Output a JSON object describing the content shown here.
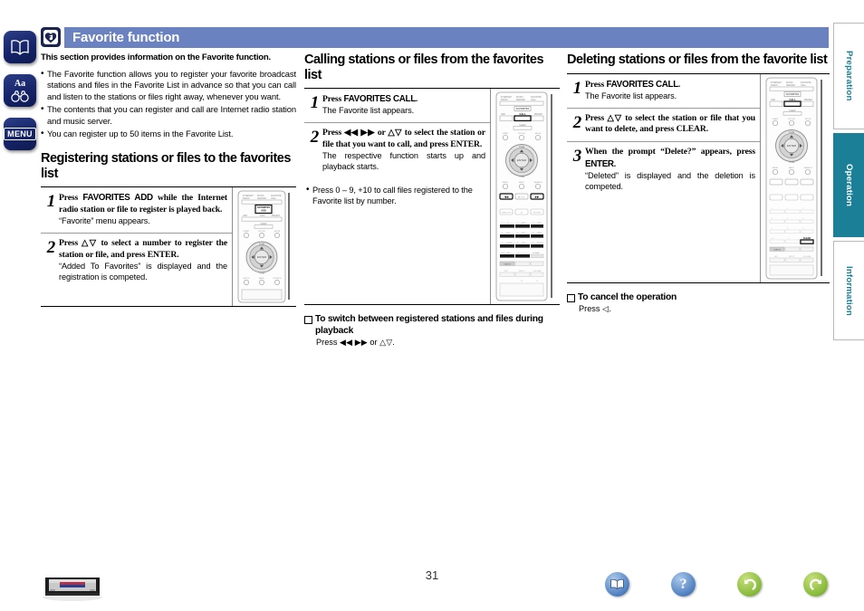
{
  "header": {
    "title": "Favorite function",
    "icon": "favorite-note-icon"
  },
  "left_rail": {
    "items": [
      {
        "name": "open-book-icon",
        "label": "Contents"
      },
      {
        "name": "aa-binoculars-icon",
        "label": "Aa"
      },
      {
        "name": "menu-icon",
        "label": "MENU"
      }
    ]
  },
  "column_a": {
    "lead": "This section provides information on the Favorite function.",
    "bullets": [
      "The Favorite function allows you to register your favorite broadcast stations and files in the Favorite List in advance so that you can call and listen to the stations or files right away, whenever you want.",
      "The contents that you can register and call are Internet radio station and music server.",
      "You can register up to 50 items in the Favorite List."
    ],
    "section_title": "Registering stations or files to the favorites list",
    "steps": [
      {
        "num": "1",
        "main_pre": "Press ",
        "main_key": "FAVORITES ADD",
        "main_post": " while the Internet radio station or file to register is played back.",
        "sub": "“Favorite” menu appears."
      },
      {
        "num": "2",
        "main_pre": "Press ",
        "main_key": "△▽",
        "main_post": " to select a number to register the station or file, and press ENTER.",
        "sub": "“Added To Favorites” is displayed and the registration is competed."
      }
    ]
  },
  "column_b": {
    "section_title": "Calling stations or files from the favorites list",
    "steps": [
      {
        "num": "1",
        "main_pre": "Press ",
        "main_key": "FAVORITES CALL",
        "main_post": ".",
        "sub": "The Favorite list appears."
      },
      {
        "num": "2",
        "main_pre": "Press ",
        "main_key": "◀◀ ▶▶",
        "main_post": " or △▽ to select the station or file that you want to call, and press ENTER.",
        "sub": "The respective function starts up and playback starts."
      }
    ],
    "note": "Press 0 – 9, +10 to call files registered to the Favorite list by number.",
    "note_keys": [
      "0 – 9",
      "+10"
    ],
    "subsection": {
      "heading": "To switch between registered stations and files during playback",
      "body": "Press ◀◀ ▶▶ or △▽."
    }
  },
  "column_c": {
    "section_title": "Deleting stations or files from the favorite list",
    "steps": [
      {
        "num": "1",
        "main_pre": "Press ",
        "main_key": "FAVORITES CALL",
        "main_post": ".",
        "sub": "The Favorite list appears."
      },
      {
        "num": "2",
        "main_pre": "Press ",
        "main_key": "△▽",
        "main_post": " to select the station or file that you want to delete, and press CLEAR.",
        "sub": ""
      },
      {
        "num": "3",
        "main_pre": "When the prompt “Delete?” appears, press ",
        "main_key": "ENTER",
        "main_post": ".",
        "sub": "“Deleted” is displayed and the deletion is competed."
      }
    ],
    "subsection": {
      "heading": "To cancel the operation",
      "body": "Press ◁."
    }
  },
  "side_tabs": [
    {
      "label": "Preparation",
      "active": false
    },
    {
      "label": "Operation",
      "active": true
    },
    {
      "label": "Information",
      "active": false
    }
  ],
  "footer": {
    "page_number": "31",
    "device_icon": "av-receiver-icon",
    "icons": [
      {
        "name": "book-icon",
        "color": "#4f7fc0"
      },
      {
        "name": "question-mark-icon",
        "color": "#4f7fc0"
      },
      {
        "name": "back-arrow-icon",
        "color": "#86b93a"
      },
      {
        "name": "forward-arrow-icon",
        "color": "#86b93a"
      }
    ]
  },
  "colors": {
    "header_bar": "#6b82c0",
    "header_icon": "#1b2550",
    "active_tab": "#1b7f97",
    "rail_button": "#16246a"
  }
}
